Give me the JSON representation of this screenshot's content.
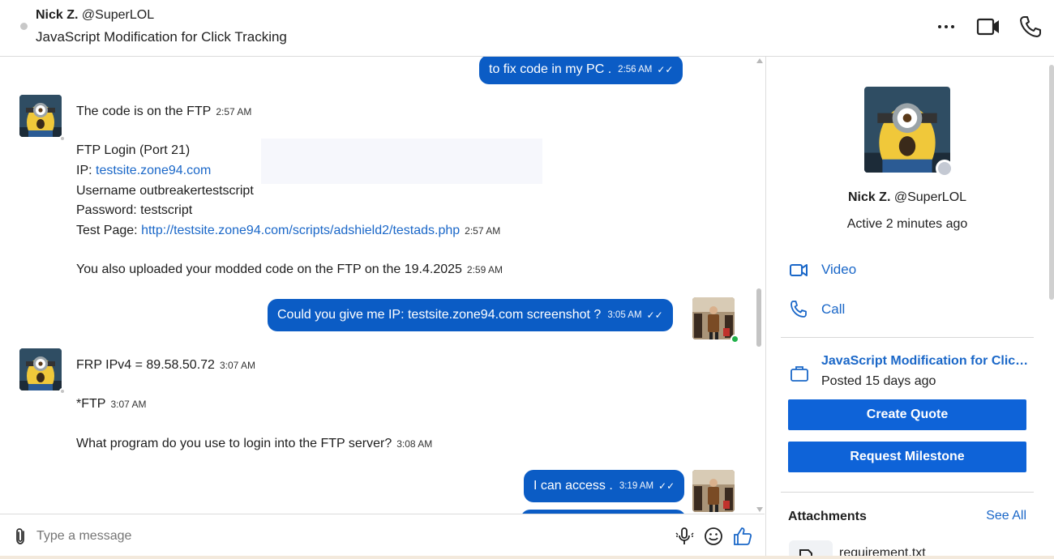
{
  "header": {
    "name": "Nick Z.",
    "handle": "@SuperLOL",
    "project_title": "JavaScript Modification for Click Tracking"
  },
  "messages": {
    "m0": {
      "text": "to fix code in my PC .",
      "time": "2:56 AM"
    },
    "m1": {
      "text": "The code is on the FTP",
      "time": "2:57 AM"
    },
    "m2": {
      "line1": "FTP Login (Port 21)",
      "ip_label": "IP:",
      "ip_link": "testsite.zone94.com",
      "username": "Username outbreakertestscript",
      "password": "Password: testscript",
      "testpage_label": "Test Page:",
      "testpage_link": "http://testsite.zone94.com/scripts/adshield2/testads.php",
      "time": "2:57 AM"
    },
    "m3": {
      "text": "You also uploaded your modded code on the FTP on the 19.4.2025",
      "time": "2:59 AM"
    },
    "m4": {
      "text": "Could you give me IP: testsite.zone94.com screenshot ?",
      "time": "3:05 AM"
    },
    "m5": {
      "text": "FRP IPv4 = 89.58.50.72",
      "time": "3:07 AM"
    },
    "m6": {
      "text": "*FTP",
      "time": "3:07 AM"
    },
    "m7": {
      "text": "What program do you use to login into the FTP server?",
      "time": "3:08 AM"
    },
    "m8": {
      "text": "I can access .",
      "time": "3:19 AM"
    }
  },
  "input": {
    "placeholder": "Type a message"
  },
  "panel": {
    "name": "Nick Z.",
    "handle": "@SuperLOL",
    "active": "Active 2 minutes ago",
    "video_label": "Video",
    "call_label": "Call",
    "job_title": "JavaScript Modification for Click Tracking",
    "posted": "Posted 15 days ago",
    "create_quote": "Create Quote",
    "request_milestone": "Request Milestone",
    "attachments_label": "Attachments",
    "see_all": "See All",
    "file_name": "requirement.txt"
  },
  "colors": {
    "bubble": "#0b5cc5",
    "link": "#1a67c8",
    "button": "#0e63d8",
    "online": "#21b14a"
  },
  "icons": [
    "more-icon",
    "video-camera-icon",
    "phone-icon",
    "paperclip-icon",
    "microphone-icon",
    "emoji-icon",
    "thumbs-up-icon",
    "briefcase-icon",
    "file-icon"
  ]
}
